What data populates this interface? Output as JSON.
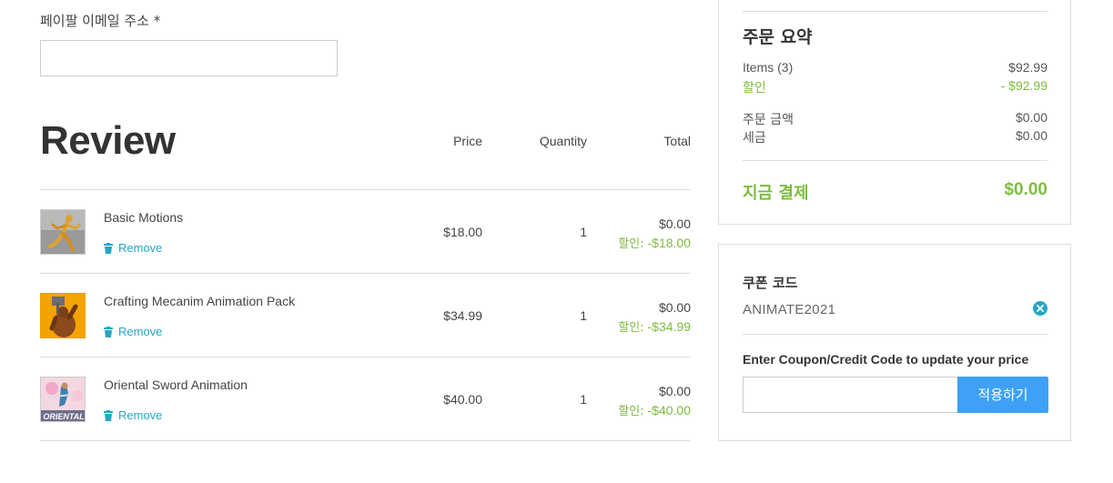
{
  "email": {
    "label": "페이팔 이메일 주소 *",
    "value": "",
    "placeholder": ""
  },
  "review": {
    "title": "Review",
    "columns": {
      "price": "Price",
      "quantity": "Quantity",
      "total": "Total"
    },
    "items": [
      {
        "name": "Basic Motions",
        "remove": "Remove",
        "price": "$18.00",
        "qty": "1",
        "total": "$0.00",
        "discount_label": "할인:",
        "discount": "-$18.00",
        "thumb_icon": "running-figure-thumbnail"
      },
      {
        "name": "Crafting Mecanim Animation Pack",
        "remove": "Remove",
        "price": "$34.99",
        "qty": "1",
        "total": "$0.00",
        "discount_label": "할인:",
        "discount": "-$34.99",
        "thumb_icon": "hammer-character-thumbnail"
      },
      {
        "name": "Oriental Sword Animation",
        "remove": "Remove",
        "price": "$40.00",
        "qty": "1",
        "total": "$0.00",
        "discount_label": "할인:",
        "discount": "-$40.00",
        "thumb_icon": "oriental-sword-thumbnail",
        "thumb_text": "ORIENTAL"
      }
    ]
  },
  "summary": {
    "title": "주문 요약",
    "items_label": "Items (3)",
    "items_value": "$92.99",
    "discount_label": "할인",
    "discount_value": "- $92.99",
    "order_amount_label": "주문 금액",
    "order_amount_value": "$0.00",
    "tax_label": "세금",
    "tax_value": "$0.00",
    "pay_now_label": "지금 결제",
    "pay_now_value": "$0.00"
  },
  "coupon": {
    "title": "쿠폰 코드",
    "code": "ANIMATE2021",
    "hint": "Enter Coupon/Credit Code to update your price",
    "input_value": "",
    "apply_label": "적용하기"
  },
  "colors": {
    "accent_blue": "#3ea1f5",
    "link_teal": "#26a6c6",
    "discount_green": "#7cbc3d"
  }
}
